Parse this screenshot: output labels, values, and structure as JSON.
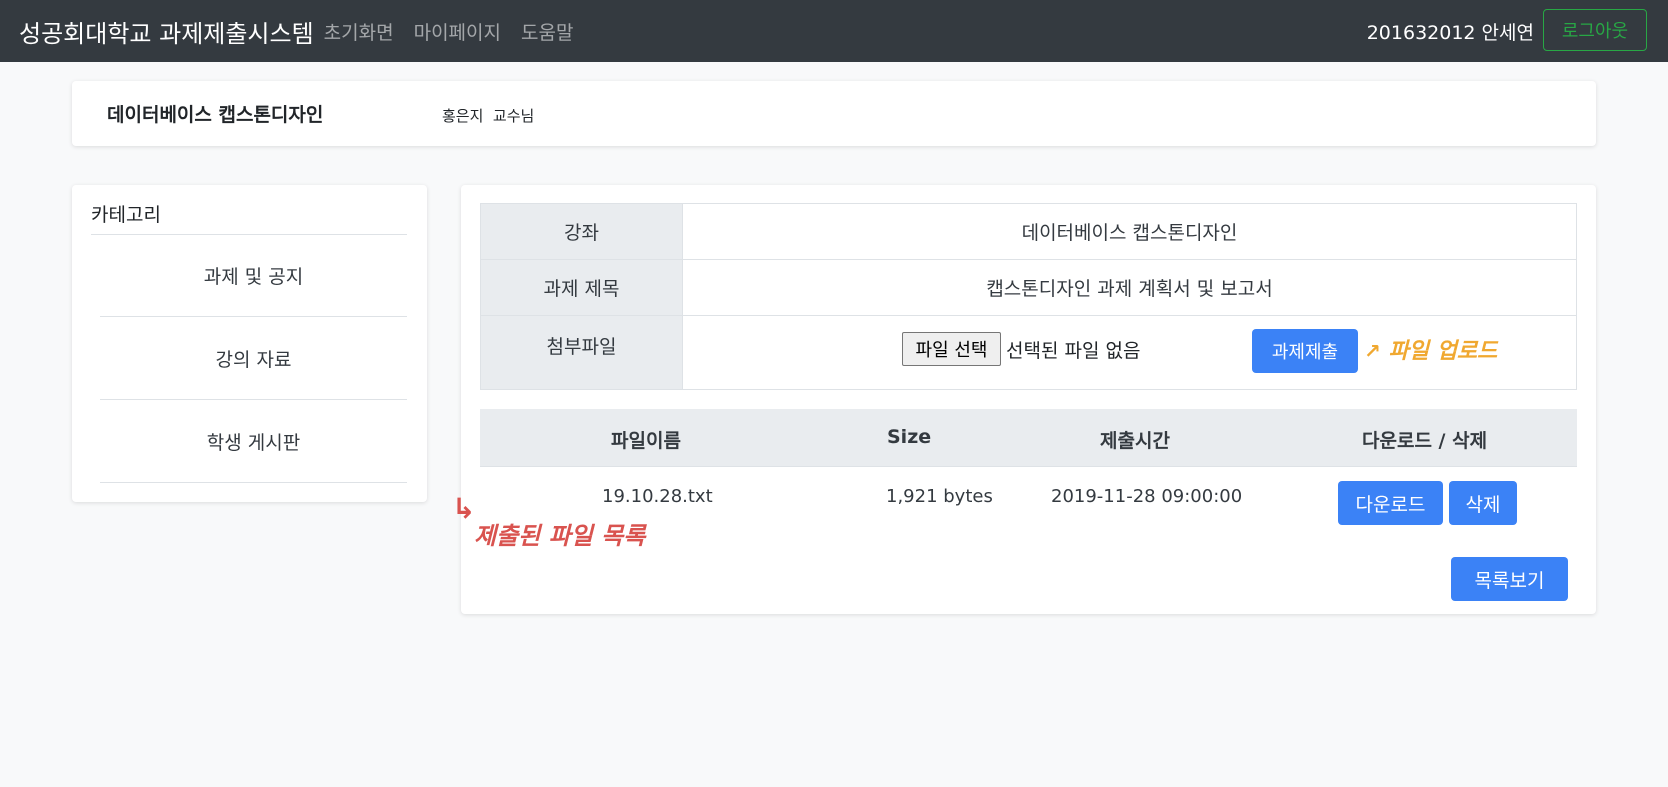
{
  "nav": {
    "brand": "성공회대학교 과제제출시스템",
    "links": [
      "초기화면",
      "마이페이지",
      "도움말"
    ],
    "user": "201632012 안세연",
    "logout_label": "로그아웃"
  },
  "course": {
    "title": "데이터베이스 캡스톤디자인",
    "professor": "홍은지  교수님"
  },
  "sidebar": {
    "heading": "카테고리",
    "items": [
      {
        "label": "과제 및 공지"
      },
      {
        "label": "강의 자료"
      },
      {
        "label": "학생 게시판"
      }
    ]
  },
  "assignment": {
    "course_label": "강좌",
    "course_value": "데이터베이스 캡스톤디자인",
    "title_label": "과제 제목",
    "title_value": "캡스톤디자인 과제 계획서 및 보고서",
    "attach_label": "첨부파일",
    "choose_file_label": "파일 선택",
    "no_file_text": "선택된 파일 없음",
    "submit_label": "과제제출"
  },
  "files_table": {
    "columns": [
      "파일이름",
      "Size",
      "제출시간",
      "다운로드 / 삭제"
    ],
    "rows": [
      {
        "name": "19.10.28.txt",
        "size": "1,921 bytes",
        "time": "2019-11-28 09:00:00",
        "download_label": "다운로드",
        "delete_label": "삭제"
      }
    ],
    "list_button_label": "목록보기"
  },
  "annotations": {
    "upload_note": "파일 업로드",
    "files_note": "제출된 파일 목록",
    "upload_color": "#f0a830",
    "files_color": "#d9534f"
  },
  "colors": {
    "navbar": "#343a40",
    "primary": "#3b82f6",
    "success": "#28a745"
  }
}
